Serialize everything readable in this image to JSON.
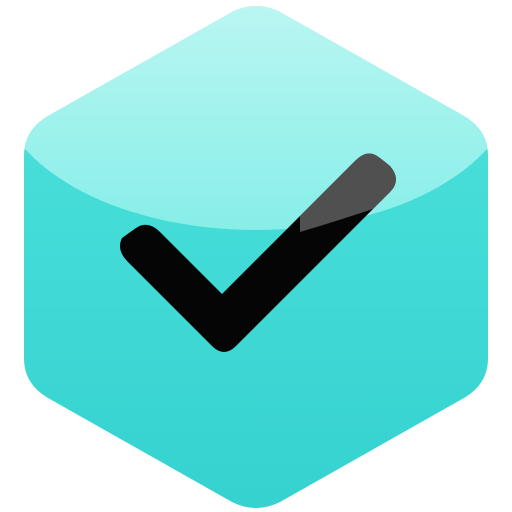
{
  "icon": {
    "name": "checkmark-icon",
    "shape": "hexagon",
    "colors": {
      "hex_top": "#4fe3dc",
      "hex_bottom": "#35d2d0",
      "highlight_top": "#d9fbf8",
      "highlight_bottom": "#8ff0ea",
      "check": "#050505",
      "check_gloss": "#6a6a6a"
    }
  }
}
